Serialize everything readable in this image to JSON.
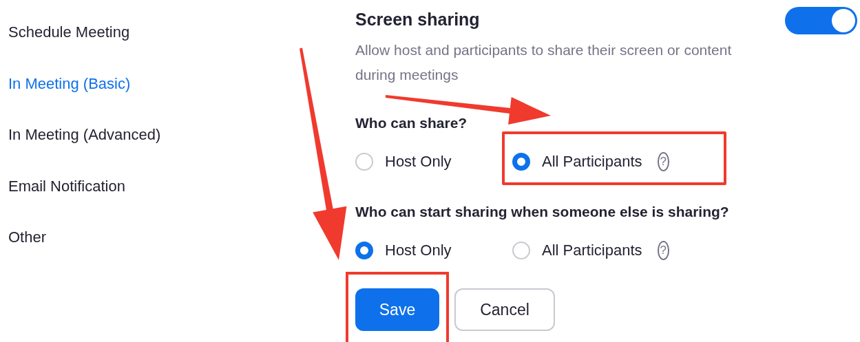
{
  "sidebar": {
    "items": [
      {
        "label": "Schedule Meeting",
        "selected": false
      },
      {
        "label": "In Meeting (Basic)",
        "selected": true
      },
      {
        "label": "In Meeting (Advanced)",
        "selected": false
      },
      {
        "label": "Email Notification",
        "selected": false
      },
      {
        "label": "Other",
        "selected": false
      }
    ]
  },
  "setting": {
    "title": "Screen sharing",
    "on": true,
    "description": "Allow host and participants to share their screen or content during meetings"
  },
  "questions": [
    {
      "label": "Who can share?",
      "options": [
        {
          "label": "Host Only",
          "selected": false,
          "highlighted": false
        },
        {
          "label": "All Participants",
          "selected": true,
          "highlighted": true,
          "help": "?"
        }
      ]
    },
    {
      "label": "Who can start sharing when someone else is sharing?",
      "options": [
        {
          "label": "Host Only",
          "selected": true,
          "highlighted": false
        },
        {
          "label": "All Participants",
          "selected": false,
          "highlighted": false,
          "help": "?"
        }
      ]
    }
  ],
  "buttons": [
    {
      "label": "Save",
      "kind": "primary",
      "highlighted": true
    },
    {
      "label": "Cancel",
      "kind": "secondary",
      "highlighted": false
    }
  ]
}
